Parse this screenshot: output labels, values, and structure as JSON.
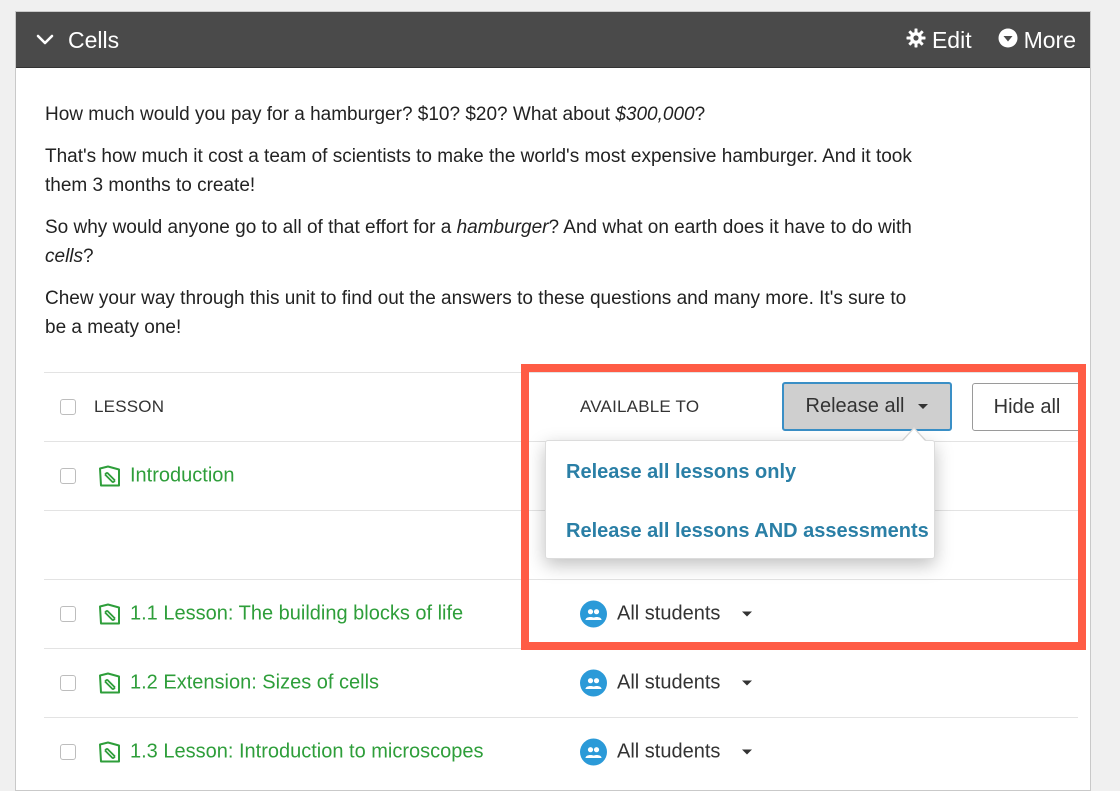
{
  "panel": {
    "title": "Cells",
    "actions": {
      "edit_label": "Edit",
      "more_label": "More"
    }
  },
  "intro": {
    "p1_a": "How much would you pay for a hamburger? $10? $20? What about ",
    "p1_em": "$300,000",
    "p1_b": "?",
    "p2": "That's how much it cost a team of scientists to make the world's most expensive hamburger. And it took them 3 months to create!",
    "p3_a": "So why would anyone go to all of that effort for a ",
    "p3_em1": "hamburger",
    "p3_b": "? And what on earth does it have to do with ",
    "p3_em2": "cells",
    "p3_c": "?",
    "p4": "Chew your way through this unit to find out the answers to these questions and many more. It's sure to be a meaty one!"
  },
  "table": {
    "header": {
      "lesson_label": "LESSON",
      "available_label": "AVAILABLE TO",
      "release_all_label": "Release all",
      "hide_all_label": "Hide all"
    },
    "rows": [
      {
        "title": "Introduction",
        "available_to": ""
      },
      {
        "title": "",
        "available_to": ""
      },
      {
        "title": "1.1 Lesson: The building blocks of life",
        "available_to": "All students"
      },
      {
        "title": "1.2 Extension: Sizes of cells",
        "available_to": "All students"
      },
      {
        "title": "1.3 Lesson: Introduction to microscopes",
        "available_to": "All students"
      }
    ]
  },
  "release_menu": {
    "items": [
      {
        "label": "Release all lessons only"
      },
      {
        "label": "Release all lessons AND assessments"
      }
    ]
  },
  "colors": {
    "header_bg": "#4a4a4a",
    "lesson_green": "#2e9e3a",
    "menu_blue": "#2a7fa6",
    "group_icon_blue": "#2b9ad8",
    "highlight_red": "#ff5c45",
    "release_border": "#3a8fc6"
  },
  "icons": {
    "collapse": "chevron-down-icon",
    "edit": "gear-icon",
    "more": "chevron-circle-down-icon",
    "lesson": "lesson-document-icon",
    "audience": "group-icon"
  }
}
